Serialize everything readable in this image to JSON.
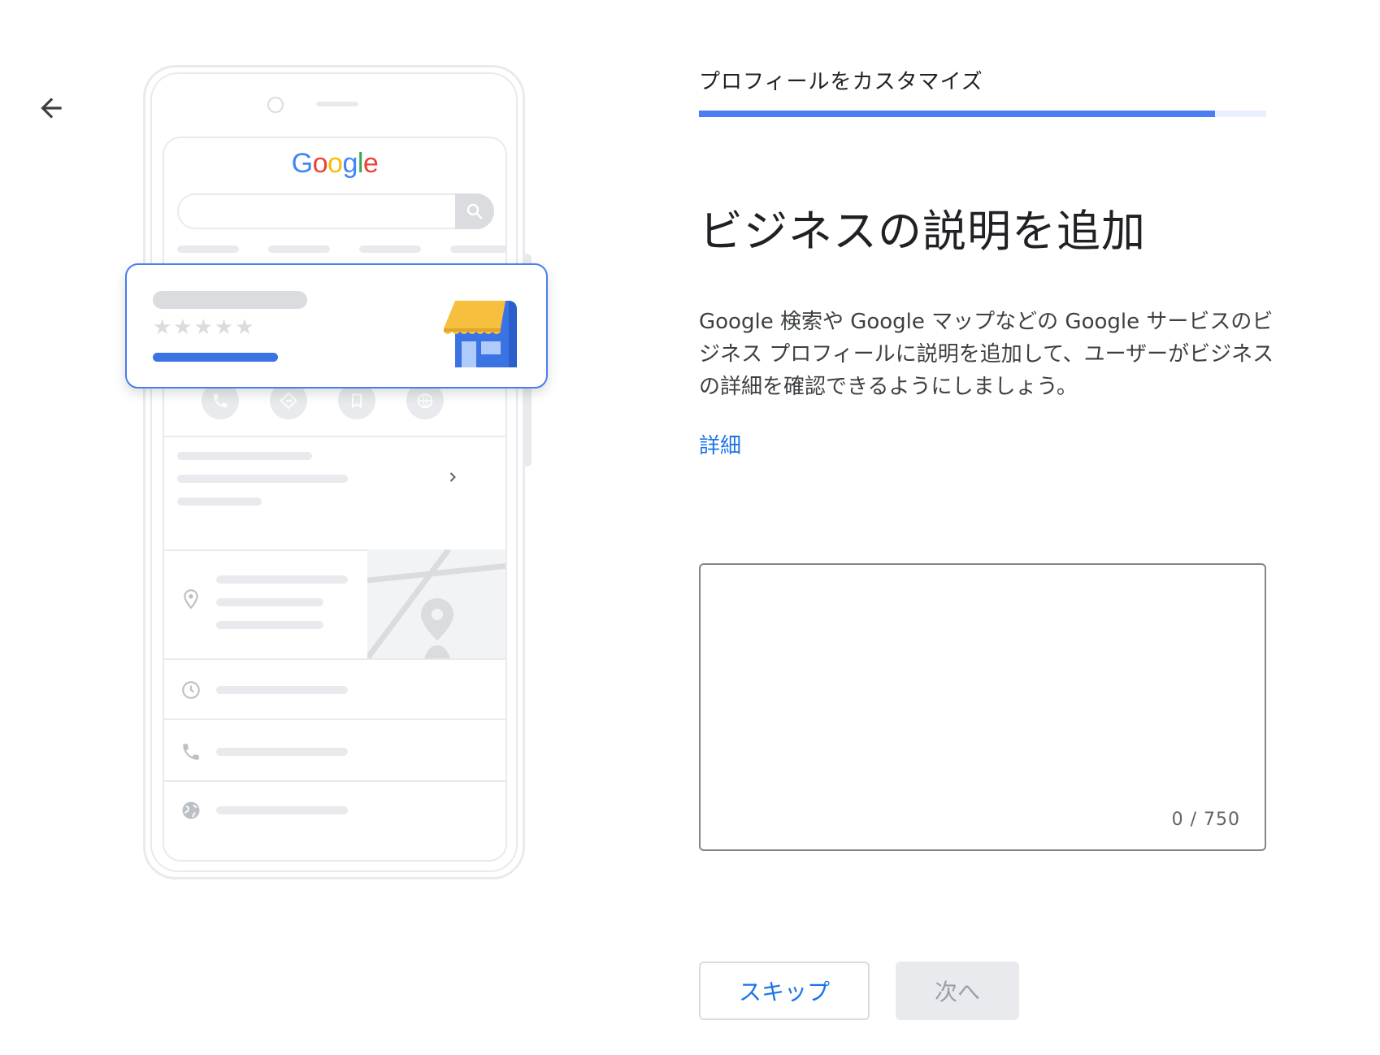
{
  "nav": {
    "back_label": "Back"
  },
  "illustration": {
    "logo_letters": [
      {
        "ch": "G",
        "color": "#4285f4"
      },
      {
        "ch": "o",
        "color": "#ea4335"
      },
      {
        "ch": "o",
        "color": "#fbbc05"
      },
      {
        "ch": "g",
        "color": "#4285f4"
      },
      {
        "ch": "l",
        "color": "#34a853"
      },
      {
        "ch": "e",
        "color": "#ea4335"
      }
    ],
    "stars": "★★★★★"
  },
  "header": {
    "step_title": "プロフィールをカスタマイズ",
    "progress_fraction": 0.91
  },
  "main": {
    "heading": "ビジネスの説明を追加",
    "description": "Google 検索や Google マップなどの Google サービスのビジネス プロフィールに説明を追加して、ユーザーがビジネスの詳細を確認できるようにしましょう。",
    "learn_more": "詳細"
  },
  "description_field": {
    "value": "",
    "counter": "0 / 750"
  },
  "actions": {
    "skip_label": "スキップ",
    "next_label": "次へ"
  },
  "colors": {
    "accent": "#1a73e8",
    "progress": "#4a7df0",
    "store_awning": "#f6bf3d",
    "store_body": "#3b72e4"
  }
}
